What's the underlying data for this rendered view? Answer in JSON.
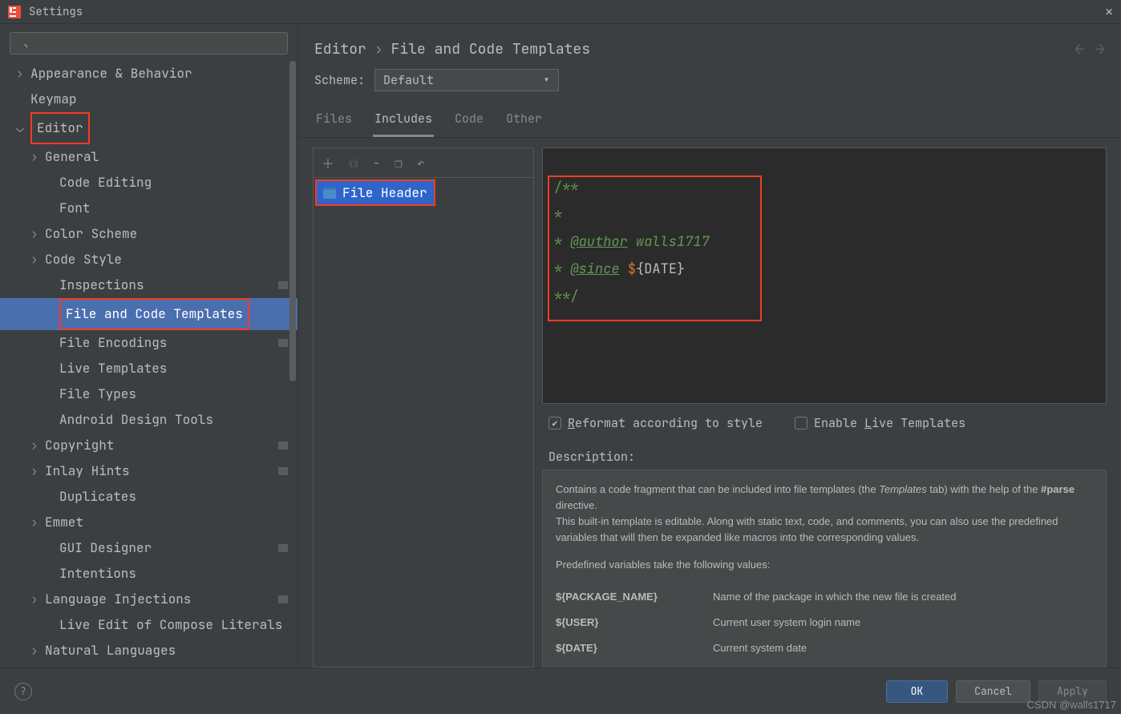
{
  "window": {
    "title": "Settings"
  },
  "search": {
    "placeholder": ""
  },
  "tree": [
    {
      "label": "Appearance & Behavior",
      "level": 1,
      "chev": "›",
      "badge": false
    },
    {
      "label": "Keymap",
      "level": 1,
      "chev": "",
      "badge": false
    },
    {
      "label": "Editor",
      "level": 1,
      "chev": "⌄",
      "badge": false,
      "red": true
    },
    {
      "label": "General",
      "level": 2,
      "chev": "›",
      "badge": false
    },
    {
      "label": "Code Editing",
      "level": 3,
      "chev": "",
      "badge": false
    },
    {
      "label": "Font",
      "level": 3,
      "chev": "",
      "badge": false
    },
    {
      "label": "Color Scheme",
      "level": 2,
      "chev": "›",
      "badge": false
    },
    {
      "label": "Code Style",
      "level": 2,
      "chev": "›",
      "badge": false
    },
    {
      "label": "Inspections",
      "level": 3,
      "chev": "",
      "badge": true
    },
    {
      "label": "File and Code Templates",
      "level": 3,
      "chev": "",
      "badge": false,
      "selected": true,
      "red": true
    },
    {
      "label": "File Encodings",
      "level": 3,
      "chev": "",
      "badge": true
    },
    {
      "label": "Live Templates",
      "level": 3,
      "chev": "",
      "badge": false
    },
    {
      "label": "File Types",
      "level": 3,
      "chev": "",
      "badge": false
    },
    {
      "label": "Android Design Tools",
      "level": 3,
      "chev": "",
      "badge": false
    },
    {
      "label": "Copyright",
      "level": 2,
      "chev": "›",
      "badge": true
    },
    {
      "label": "Inlay Hints",
      "level": 2,
      "chev": "›",
      "badge": true
    },
    {
      "label": "Duplicates",
      "level": 3,
      "chev": "",
      "badge": false
    },
    {
      "label": "Emmet",
      "level": 2,
      "chev": "›",
      "badge": false
    },
    {
      "label": "GUI Designer",
      "level": 3,
      "chev": "",
      "badge": true
    },
    {
      "label": "Intentions",
      "level": 3,
      "chev": "",
      "badge": false
    },
    {
      "label": "Language Injections",
      "level": 2,
      "chev": "›",
      "badge": true
    },
    {
      "label": "Live Edit of Compose Literals",
      "level": 3,
      "chev": "",
      "badge": false
    },
    {
      "label": "Natural Languages",
      "level": 2,
      "chev": "›",
      "badge": false
    }
  ],
  "breadcrumb": {
    "a": "Editor",
    "sep": "›",
    "b": "File and Code Templates"
  },
  "scheme": {
    "label": "Scheme:",
    "value": "Default"
  },
  "tabs": [
    "Files",
    "Includes",
    "Code",
    "Other"
  ],
  "activeTab": 1,
  "fileList": {
    "item": "File Header"
  },
  "editor": {
    "l1": "/**",
    "l2": "*",
    "l3star": "* ",
    "l3tag": "@author",
    "l3txt": " walls1717",
    "l4star": "* ",
    "l4tag": "@since",
    "l4sp": " ",
    "l4d": "$",
    "l4lb": "{",
    "l4v": "DATE",
    "l4rb": "}",
    "l5": "**/"
  },
  "opts": {
    "reformat_pre": "R",
    "reformat_post": "eformat according to style",
    "live_pre": "Enable ",
    "live_u": "L",
    "live_post": "ive Templates"
  },
  "desc": {
    "label": "Description:",
    "p1a": "Contains a code fragment that can be included into file templates (the ",
    "p1b": "Templates",
    "p1c": " tab) with the help of the ",
    "p1d": "#parse",
    "p1e": " directive.",
    "p2": "This built-in template is editable. Along with static text, code, and comments, you can also use the predefined variables that will then be expanded like macros into the corresponding values.",
    "p3": "Predefined variables take the following values:",
    "vars": [
      {
        "name": "${PACKAGE_NAME}",
        "desc": "Name of the package in which the new file is created"
      },
      {
        "name": "${USER}",
        "desc": "Current user system login name"
      },
      {
        "name": "${DATE}",
        "desc": "Current system date"
      }
    ]
  },
  "buttons": {
    "ok": "OK",
    "cancel": "Cancel",
    "apply": "Apply"
  },
  "watermark": "CSDN @walls1717"
}
